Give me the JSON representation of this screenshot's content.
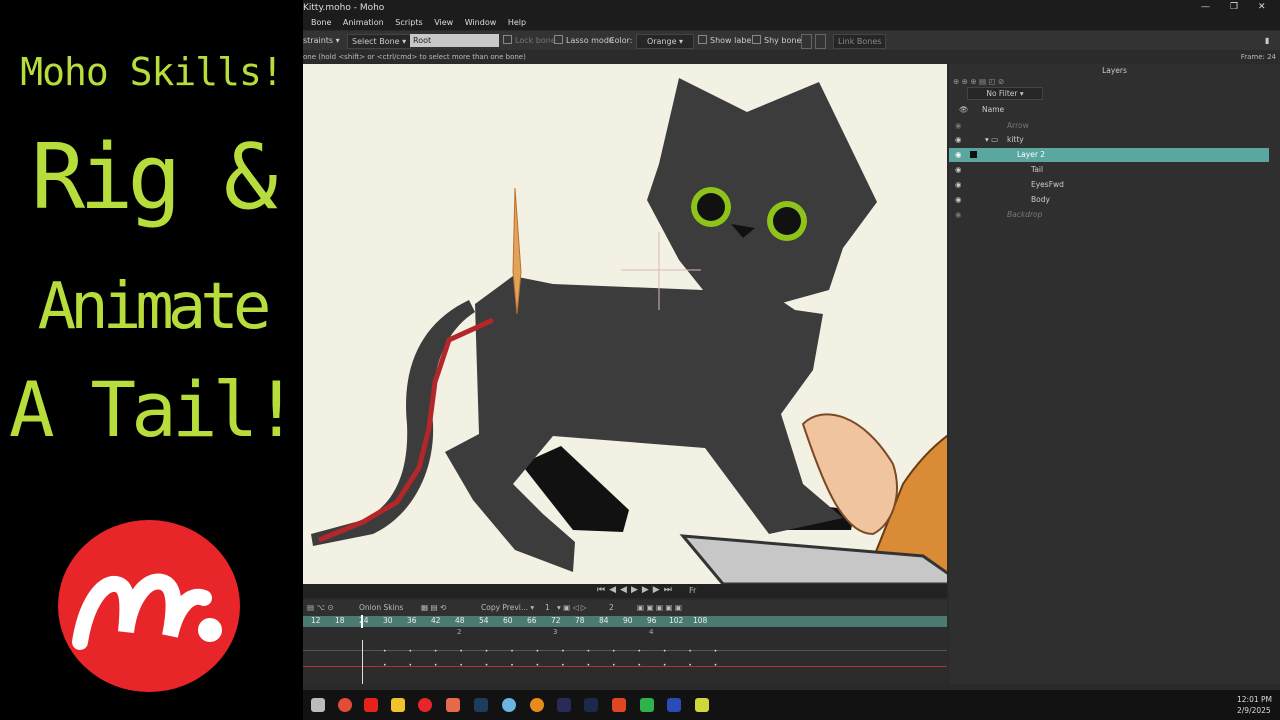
{
  "promo": {
    "line1": "Moho Skills!",
    "line2": "Rig &",
    "line3": "Animate",
    "line4": "A Tail!",
    "logo_mark": "m."
  },
  "window": {
    "title": "Kitty.moho - Moho",
    "controls": [
      "—",
      "❐",
      "✕"
    ]
  },
  "menu": [
    "Bone",
    "Animation",
    "Scripts",
    "View",
    "Window",
    "Help"
  ],
  "toolbar": {
    "constraints_label": "straints",
    "select_bone_label": "Select Bone",
    "bone_name_value": "Root",
    "lock_bone_label": "Lock bone",
    "lasso_mode_label": "Lasso mode",
    "color_label": "Color:",
    "color_value": "Orange",
    "show_label_label": "Show label",
    "shy_bone_label": "Shy bone",
    "link_bones_label": "Link Bones"
  },
  "hint": {
    "text": "one (hold <shift> or <ctrl/cmd> to select more than one bone)",
    "frame": "Frame: 24"
  },
  "layers": {
    "title": "Layers",
    "filter": "No Filter",
    "name_header": "Name",
    "rows": [
      {
        "name": "Arrow",
        "indent": 0
      },
      {
        "name": "kitty",
        "indent": 1
      },
      {
        "name": "Layer 2",
        "indent": 2
      },
      {
        "name": "Tail",
        "indent": 3
      },
      {
        "name": "EyesFwd",
        "indent": 3
      },
      {
        "name": "Body",
        "indent": 3
      },
      {
        "name": "Backdrop",
        "indent": 0
      }
    ]
  },
  "timeline": {
    "onion_skins_label": "Onion Skins",
    "copy_preview_label": "Copy Previ...",
    "step_value": "1",
    "keys_value": "2",
    "ruler": [
      "12",
      "18",
      "24",
      "30",
      "36",
      "42",
      "48",
      "54",
      "60",
      "66",
      "72",
      "78",
      "84",
      "90",
      "96",
      "102",
      "108"
    ],
    "markers": [
      "2",
      "3",
      "4"
    ],
    "frame_field": "Fr"
  },
  "taskbar": {
    "time": "12:01 PM",
    "date": "2/9/2025",
    "icons": [
      "windows-icon",
      "chrome-icon",
      "youtube-icon",
      "folder-icon",
      "moho-icon",
      "app-icon",
      "photoshop-icon",
      "resolve-icon",
      "blender-icon",
      "after-effects-icon",
      "media-encoder-icon",
      "capcut-icon",
      "camtasia-icon",
      "vegas-icon",
      "misc-icon"
    ]
  },
  "colors": {
    "accent_green": "#b6dd3c",
    "moho_red": "#e8262a",
    "layer_selected": "#5aa79f",
    "cat_body": "#3c3c3c",
    "eye_green": "#8ec31a"
  }
}
